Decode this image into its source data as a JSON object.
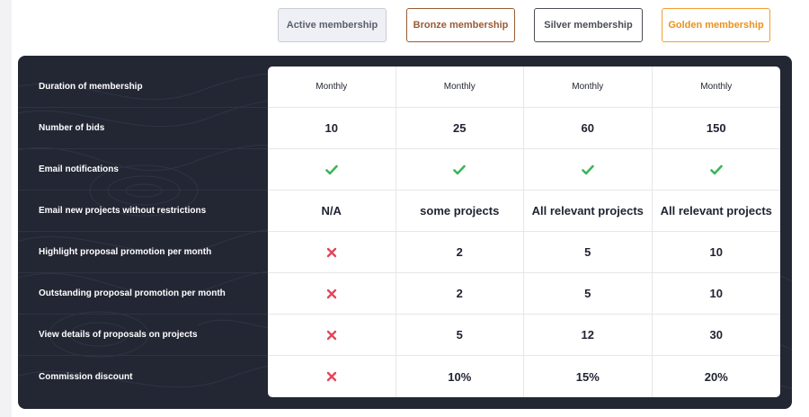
{
  "plans": [
    {
      "label": "Active membership"
    },
    {
      "label": "Bronze membership"
    },
    {
      "label": "Silver membership"
    },
    {
      "label": "Golden membership"
    }
  ],
  "features": [
    {
      "label": "Duration of membership",
      "values": [
        "Monthly",
        "Monthly",
        "Monthly",
        "Monthly"
      ]
    },
    {
      "label": "Number of bids",
      "values": [
        "10",
        "25",
        "60",
        "150"
      ]
    },
    {
      "label": "Email notifications",
      "values": [
        "check",
        "check",
        "check",
        "check"
      ]
    },
    {
      "label": "Email new projects without restrictions",
      "values": [
        "N/A",
        "some projects",
        "All relevant projects",
        "All relevant projects"
      ]
    },
    {
      "label": "Highlight proposal promotion per month",
      "values": [
        "cross",
        "2",
        "5",
        "10"
      ]
    },
    {
      "label": "Outstanding proposal promotion per month",
      "values": [
        "cross",
        "2",
        "5",
        "10"
      ]
    },
    {
      "label": "View details of proposals on projects",
      "values": [
        "cross",
        "5",
        "12",
        "30"
      ]
    },
    {
      "label": "Commission discount",
      "values": [
        "cross",
        "10%",
        "15%",
        "20%"
      ]
    }
  ],
  "colors": {
    "panel": "#232734",
    "bronze": "#9a5b33",
    "silver": "#4a4d55",
    "gold": "#e8921c",
    "check": "#3cb55b",
    "cross": "#e2475a"
  }
}
